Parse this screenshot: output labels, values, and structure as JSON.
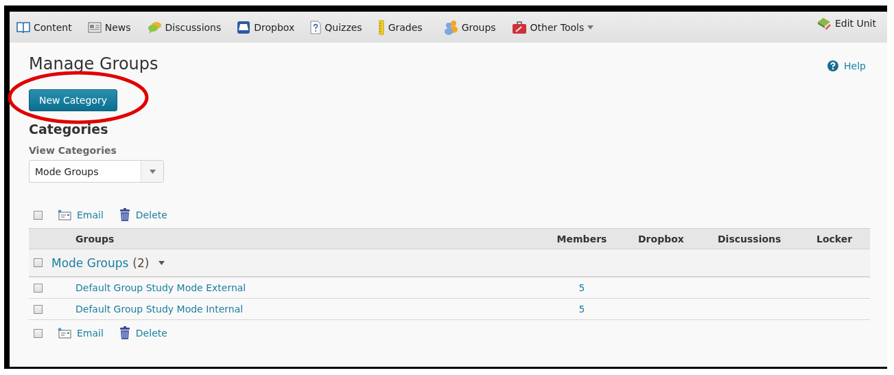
{
  "nav": {
    "items": [
      {
        "label": "Content",
        "has_menu": false
      },
      {
        "label": "News",
        "has_menu": false
      },
      {
        "label": "Discussions",
        "has_menu": false
      },
      {
        "label": "Dropbox",
        "has_menu": false
      },
      {
        "label": "Quizzes",
        "has_menu": false
      },
      {
        "label": "Grades",
        "has_menu": false
      },
      {
        "label": "Groups",
        "has_menu": false
      },
      {
        "label": "Other Tools",
        "has_menu": true
      }
    ],
    "edit_unit": "Edit Unit"
  },
  "page": {
    "title": "Manage Groups",
    "help": "Help",
    "new_button": "New Category",
    "section_title": "Categories",
    "view_label": "View Categories",
    "view_select": {
      "value": "Mode Groups"
    }
  },
  "toolbar_top": {
    "checked": false,
    "actions": [
      "Email",
      "Delete"
    ]
  },
  "table": {
    "columns": [
      "Groups",
      "Members",
      "Dropbox",
      "Discussions",
      "Locker"
    ],
    "category": {
      "label": "Mode Groups",
      "count": "(2)",
      "checked": false,
      "expanded": true
    },
    "rows": [
      {
        "name": "Default Group Study Mode External",
        "members": "5",
        "checked": false
      },
      {
        "name": "Default Group Study Mode Internal",
        "members": "5",
        "checked": false
      }
    ]
  },
  "toolbar_bottom": {
    "checked": false,
    "actions": [
      "Email",
      "Delete"
    ]
  }
}
